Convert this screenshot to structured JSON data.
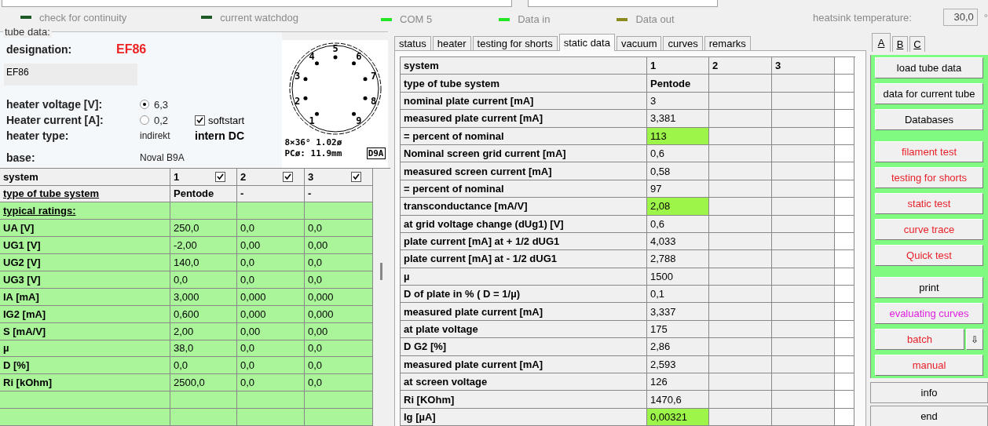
{
  "top_fields": [
    {
      "kind": "blank"
    },
    {
      "kind": "blank"
    }
  ],
  "indicators": [
    {
      "label": "check for continuity",
      "color": "#1e5a28"
    },
    {
      "label": "current watchdog",
      "color": "#1e5a28"
    },
    {
      "label": "COM 5",
      "color": "#22e622"
    },
    {
      "label": "Data in",
      "color": "#22e622"
    },
    {
      "label": "Data out",
      "color": "#8c8a1e"
    }
  ],
  "heatsink": {
    "label": "heatsink temperature:",
    "value": "30,0",
    "unit": "°"
  },
  "tube_data": {
    "legend": "tube data:",
    "designation_label": "designation:",
    "designation": "EF86",
    "description": "EF86",
    "heater_voltage": {
      "label": "heater voltage [V]:",
      "value": "6,3",
      "selected": true
    },
    "heater_current": {
      "label": "Heater current [A]:",
      "value": "0,2",
      "selected": false
    },
    "softstart": {
      "label": "softstart",
      "checked": true
    },
    "heater_type": {
      "label": "heater type:",
      "value": "indirekt",
      "mode": "intern DC"
    },
    "base": {
      "label": "base:",
      "value": "Noval B9A"
    },
    "pin_diagram": {
      "pins": [
        "5",
        "6",
        "7",
        "8",
        "9",
        "1",
        "2",
        "3",
        "4"
      ],
      "spec_line_1": "8×36°  1.02ø",
      "spec_line_2": "PCø: 11.9mm",
      "base_code": "D9A"
    }
  },
  "systems_table": {
    "header": "system",
    "columns": [
      {
        "label": "1",
        "checked": true
      },
      {
        "label": "2",
        "checked": true
      },
      {
        "label": "3",
        "checked": true
      }
    ],
    "type_row": {
      "label": "type of tube system",
      "values": [
        "Pentode",
        "-",
        "-"
      ]
    },
    "section_label": "typical ratings:",
    "rows": [
      {
        "label": "UA [V]",
        "values": [
          "250,0",
          "0,0",
          "0,0"
        ]
      },
      {
        "label": "UG1 [V]",
        "values": [
          "-2,00",
          "0,00",
          "0,00"
        ]
      },
      {
        "label": "UG2 [V]",
        "values": [
          "140,0",
          "0,0",
          "0,0"
        ]
      },
      {
        "label": "UG3 [V]",
        "values": [
          "0,0",
          "0,0",
          "0,0"
        ]
      },
      {
        "label": "IA [mA]",
        "values": [
          "3,000",
          "0,000",
          "0,000"
        ]
      },
      {
        "label": "IG2 [mA]",
        "values": [
          "0,600",
          "0,000",
          "0,000"
        ]
      },
      {
        "label": "S [mA/V]",
        "values": [
          "2,00",
          "0,00",
          "0,00"
        ]
      },
      {
        "label": "µ",
        "values": [
          "38,0",
          "0,0",
          "0,0"
        ]
      },
      {
        "label": "D [%]",
        "values": [
          "0,0",
          "0,0",
          "0,0"
        ]
      },
      {
        "label": "Ri [kOhm]",
        "values": [
          "2500,0",
          "0,0",
          "0,0"
        ]
      }
    ]
  },
  "tabs": [
    {
      "label": "status",
      "selected": false
    },
    {
      "label": "heater",
      "selected": false
    },
    {
      "label": "testing for shorts",
      "selected": false
    },
    {
      "label": "static data",
      "selected": true
    },
    {
      "label": "vacuum",
      "selected": false
    },
    {
      "label": "curves",
      "selected": false
    },
    {
      "label": "remarks",
      "selected": false
    }
  ],
  "static_table": {
    "columns": [
      "system",
      "1",
      "2",
      "3"
    ],
    "rows": [
      {
        "label": "type of tube system",
        "value": "Pentode",
        "highlighted": false
      },
      {
        "label": "nominal plate current [mA]",
        "value": "3",
        "highlighted": false
      },
      {
        "label": "measured plate current [mA]",
        "value": "3,381",
        "highlighted": false
      },
      {
        "label": "= percent of nominal",
        "value": "113",
        "highlighted": true
      },
      {
        "label": "Nominal screen grid current [mA]",
        "value": "0,6",
        "highlighted": false
      },
      {
        "label": "measured screen current [mA]",
        "value": "0,58",
        "highlighted": false
      },
      {
        "label": "= percent of nominal",
        "value": "97",
        "highlighted": false
      },
      {
        "label": "transconductance [mA/V]",
        "value": "2,08",
        "highlighted": true
      },
      {
        "label": "at grid voltage change (dUg1) [V]",
        "value": "0,6",
        "highlighted": false
      },
      {
        "label": "plate current [mA] at + 1/2 dUG1",
        "value": "4,033",
        "highlighted": false
      },
      {
        "label": "plate current [mA] at - 1/2 dUG1",
        "value": "2,788",
        "highlighted": false
      },
      {
        "label": "µ",
        "value": "1500",
        "highlighted": false
      },
      {
        "label": "D of plate in % ( D = 1/µ)",
        "value": "0,1",
        "highlighted": false
      },
      {
        "label": "measured plate current [mA]",
        "value": "3,337",
        "highlighted": false
      },
      {
        "label": "at plate voltage",
        "value": "175",
        "highlighted": false
      },
      {
        "label": "D G2 [%]",
        "value": "2,86",
        "highlighted": false
      },
      {
        "label": "measured plate current [mA]",
        "value": "2,593",
        "highlighted": false
      },
      {
        "label": "at screen voltage",
        "value": "126",
        "highlighted": false
      },
      {
        "label": "Ri [KOhm]",
        "value": "1470,6",
        "highlighted": false
      },
      {
        "label": "Ig [µA]",
        "value": "0,00321",
        "highlighted": true
      }
    ]
  },
  "side_tabs": [
    {
      "label": "A",
      "selected": true
    },
    {
      "label": "B",
      "selected": false
    },
    {
      "label": "C",
      "selected": false
    }
  ],
  "button_groups": [
    [
      {
        "label": "load tube data",
        "color": "#000000"
      },
      {
        "label": "data for current tube",
        "color": "#000000"
      },
      {
        "label": "Databases",
        "color": "#000000"
      }
    ],
    [
      {
        "label": "filament test",
        "color": "#e8202a"
      },
      {
        "label": "testing for shorts",
        "color": "#e8202a"
      },
      {
        "label": "static test",
        "color": "#e8202a"
      },
      {
        "label": "curve trace",
        "color": "#e8202a"
      },
      {
        "label": "Quick test",
        "color": "#e8202a"
      }
    ],
    [
      {
        "label": "print",
        "color": "#000000"
      },
      {
        "label": "evaluating curves",
        "color": "#e020e0"
      },
      {
        "label": "batch",
        "color": "#e8202a",
        "kind": "split",
        "arrow": "⇩"
      },
      {
        "label": "manual",
        "color": "#e8202a"
      }
    ]
  ],
  "footer_buttons": [
    "info",
    "end"
  ]
}
